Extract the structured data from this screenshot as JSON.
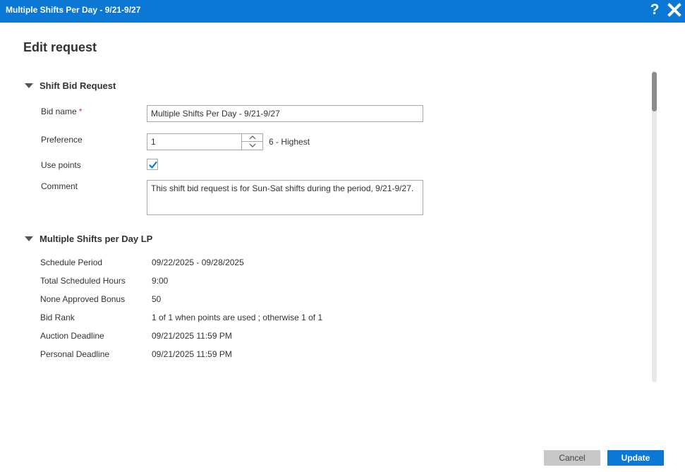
{
  "window": {
    "title": "Multiple Shifts Per Day - 9/21-9/27",
    "help_label": "?",
    "accent_color": "#0a78d4"
  },
  "page_title": "Edit request",
  "shift_bid_request": {
    "header": "Shift Bid Request",
    "bid_name": {
      "label": "Bid name",
      "required_marker": "*",
      "value": "Multiple Shifts Per Day - 9/21-9/27"
    },
    "preference": {
      "label": "Preference",
      "value": "1",
      "hint": "6 - Highest"
    },
    "use_points": {
      "label": "Use points",
      "checked": true
    },
    "comment": {
      "label": "Comment",
      "value": "This shift bid request is for Sun-Sat shifts during the period, 9/21-9/27."
    }
  },
  "details": {
    "header": "Multiple Shifts per Day LP",
    "rows": [
      {
        "label": "Schedule Period",
        "value": "09/22/2025 - 09/28/2025"
      },
      {
        "label": "Total Scheduled Hours",
        "value": "9:00"
      },
      {
        "label": "None Approved Bonus",
        "value": "50"
      },
      {
        "label": "Bid Rank",
        "value": "1 of 1 when points are used ; otherwise 1 of 1"
      },
      {
        "label": "Auction Deadline",
        "value": "09/21/2025 11:59 PM"
      },
      {
        "label": "Personal Deadline",
        "value": "09/21/2025 11:59 PM"
      }
    ]
  },
  "footer": {
    "cancel_label": "Cancel",
    "update_label": "Update"
  },
  "icons": {
    "help": "help-icon",
    "close": "close-icon",
    "section_caret": "caret-down-icon",
    "spinner_up": "chevron-up-icon",
    "spinner_down": "chevron-down-icon",
    "check": "checkmark-icon"
  }
}
